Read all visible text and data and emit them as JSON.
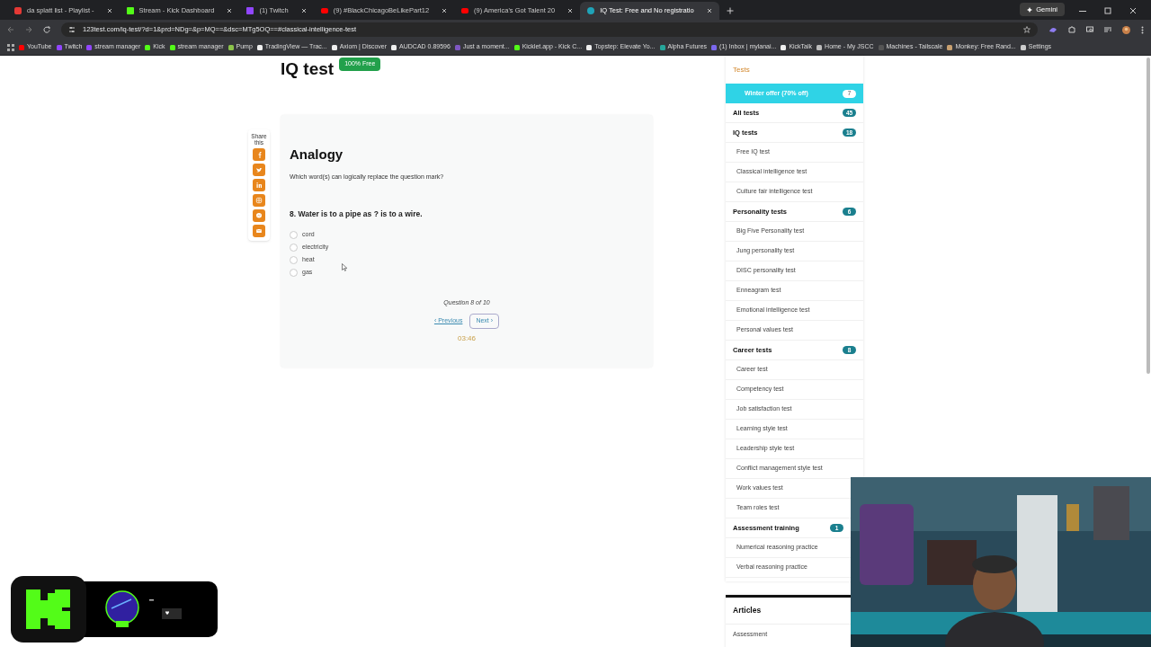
{
  "browser": {
    "tabs": [
      {
        "title": "da splatt list - Playlist - ",
        "kind": "music",
        "selected": false
      },
      {
        "title": "Stream - Kick Dashboard",
        "kind": "kick",
        "selected": false
      },
      {
        "title": "(1) Twitch",
        "kind": "twitch",
        "selected": false
      },
      {
        "title": "(9) #BlackChicagoBeLikePart12",
        "kind": "video",
        "selected": false
      },
      {
        "title": "(9) America's Got Talent 20",
        "kind": "video",
        "selected": false
      },
      {
        "title": "IQ Test: Free and No registratio",
        "kind": "site",
        "selected": true
      }
    ],
    "address": "123test.com/iq-test/?d=1&prd=NDg=&p=MQ==&dsc=MTg5OQ==#classical-intelligence-test",
    "gemini": "Gemini",
    "bookmarks": [
      "YouTube",
      "Twitch",
      "stream manager",
      "Kick",
      "stream manager",
      "Pump",
      "TradingView — Trac...",
      "Axiom | Discover",
      "AUDCAD 0.89596",
      "Just a moment...",
      "Kicklet.app - Kick C...",
      "Topstep: Elevate Yo...",
      "Alpha Futures",
      "(1) Inbox | mylanai...",
      "KickTalk",
      "Home - My JSCC",
      "Machines - Tailscale",
      "Monkey: Free Rand...",
      "Settings"
    ]
  },
  "page": {
    "title": "IQ test",
    "badge": "100% Free",
    "share_label": "Share this",
    "share_buttons": [
      {
        "kind": "facebook"
      },
      {
        "kind": "twitter"
      },
      {
        "kind": "linkedin"
      },
      {
        "kind": "instagram"
      },
      {
        "kind": "messenger"
      },
      {
        "kind": "email"
      }
    ],
    "quiz": {
      "category": "Analogy",
      "instruction": "Which word(s) can logically replace the question mark?",
      "question": "8. Water is to a pipe as ? is to a wire.",
      "options": [
        {
          "label": "cord",
          "selected": false
        },
        {
          "label": "electricity",
          "selected": false
        },
        {
          "label": "heat",
          "selected": false
        },
        {
          "label": "gas",
          "selected": false
        }
      ],
      "progress": "Question 8 of 10",
      "previous": "‹ Previous",
      "next": "Next ›",
      "timer": "03:46"
    }
  },
  "sidebar": {
    "heading": "Tests",
    "items": [
      {
        "kind": "offer",
        "label": "Winter offer (70% off)",
        "badge": "7"
      },
      {
        "kind": "group",
        "label": "All tests",
        "badge": "45"
      },
      {
        "kind": "group",
        "label": "IQ tests",
        "badge": "18"
      },
      {
        "kind": "item",
        "label": "Free IQ test"
      },
      {
        "kind": "item",
        "label": "Classical intelligence test"
      },
      {
        "kind": "item",
        "label": "Culture fair intelligence test"
      },
      {
        "kind": "group",
        "label": "Personality tests",
        "badge": "6"
      },
      {
        "kind": "item",
        "label": "Big Five Personality test"
      },
      {
        "kind": "item",
        "label": "Jung personality test"
      },
      {
        "kind": "item",
        "label": "DISC personality test"
      },
      {
        "kind": "item",
        "label": "Enneagram test"
      },
      {
        "kind": "item",
        "label": "Emotional intelligence test"
      },
      {
        "kind": "item",
        "label": "Personal values test"
      },
      {
        "kind": "group",
        "label": "Career tests",
        "badge": "8"
      },
      {
        "kind": "item",
        "label": "Career test"
      },
      {
        "kind": "item",
        "label": "Competency test"
      },
      {
        "kind": "item",
        "label": "Job satisfaction test"
      },
      {
        "kind": "item",
        "label": "Learning style test"
      },
      {
        "kind": "item",
        "label": "Leadership style test"
      },
      {
        "kind": "item",
        "label": "Conflict management style test"
      },
      {
        "kind": "item",
        "label": "Work values test"
      },
      {
        "kind": "item",
        "label": "Team roles test"
      },
      {
        "kind": "group",
        "label": "Assessment training",
        "badge": "1"
      },
      {
        "kind": "item",
        "label": "Numerical reasoning practice"
      },
      {
        "kind": "item",
        "label": "Verbal reasoning practice"
      }
    ],
    "articles": {
      "heading": "Articles",
      "items": [
        "Assessment"
      ]
    }
  }
}
